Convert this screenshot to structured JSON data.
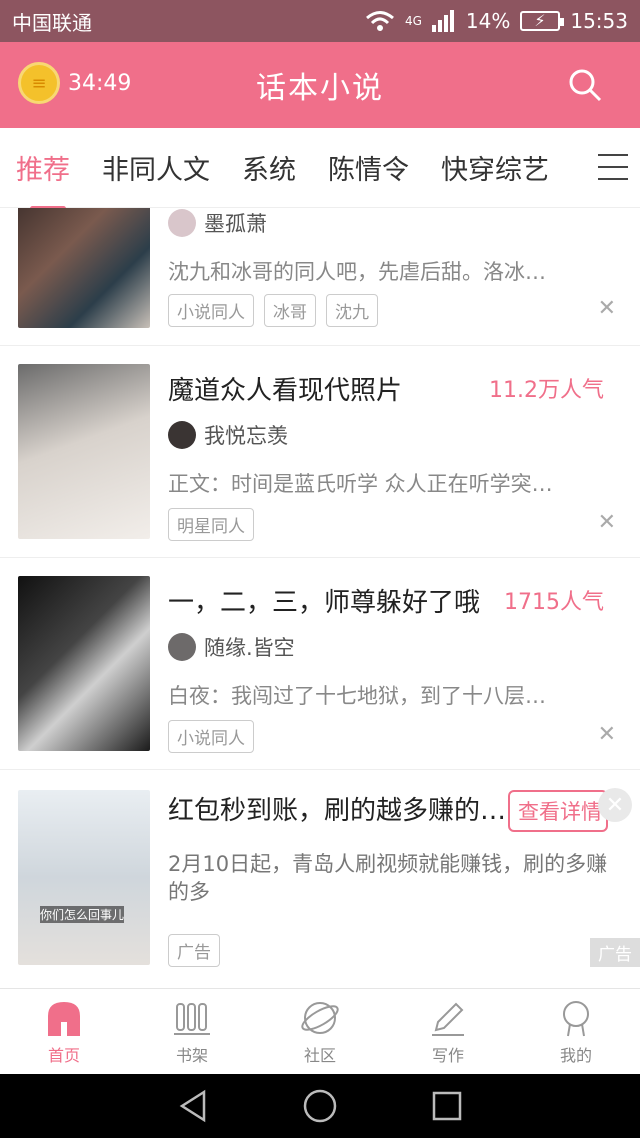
{
  "status_bar": {
    "carrier": "中国联通",
    "network": "4G",
    "battery": "14%",
    "time": "15:53"
  },
  "app_bar": {
    "timer": "34:49",
    "title": "话本小说"
  },
  "tabs": [
    "推荐",
    "非同人文",
    "系统",
    "陈情令",
    "快穿综艺"
  ],
  "cards": [
    {
      "author": "墨孤萧",
      "desc": "沈九和冰哥的同人吧，先虐后甜。洛冰…",
      "tags": [
        "小说同人",
        "冰哥",
        "沈九"
      ]
    },
    {
      "title": "魔道众人看现代照片",
      "popularity": "11.2万人气",
      "author": "我悦忘羡",
      "desc": "正文：时间是蓝氏听学 众人正在听学突…",
      "tags": [
        "明星同人"
      ]
    },
    {
      "title": "一，二，三，师尊躲好了哦",
      "popularity": "1715人气",
      "author": "随缘.皆空",
      "desc": "白夜：我闯过了十七地狱，到了十八层…",
      "tags": [
        "小说同人"
      ]
    }
  ],
  "ad": {
    "title": "红包秒到账，刷的越多赚的…",
    "button": "查看详情",
    "desc": "2月10日起，青岛人刷视频就能赚钱，刷的多赚的多",
    "tag": "广告",
    "badge": "广告",
    "image_caption": "你们怎么回事儿"
  },
  "bottom_nav": [
    "首页",
    "书架",
    "社区",
    "写作",
    "我的"
  ],
  "colors": {
    "accent": "#f06f8a",
    "status_bar": "#8d5560"
  }
}
